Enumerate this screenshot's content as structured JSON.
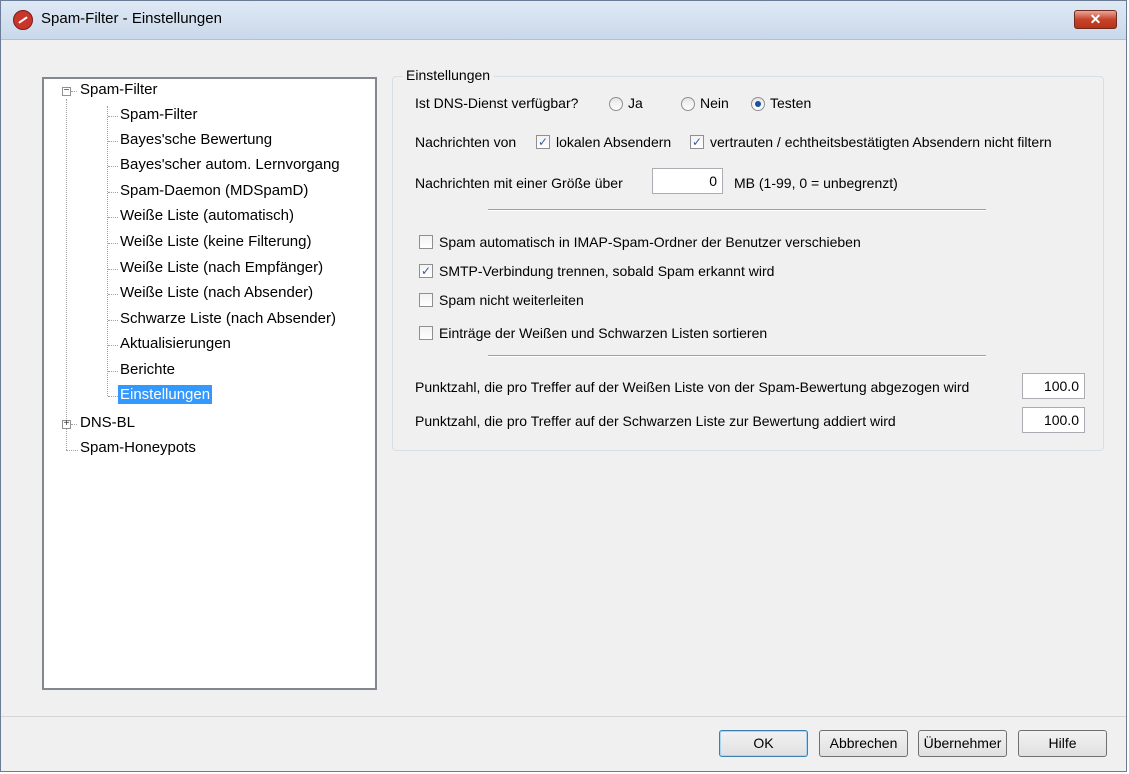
{
  "window": {
    "title": "Spam-Filter - Einstellungen",
    "close_label": "✕"
  },
  "tree": {
    "root": "Spam-Filter",
    "children": [
      "Spam-Filter",
      "Bayes'sche Bewertung",
      "Bayes'scher autom. Lernvorgang",
      "Spam-Daemon (MDSpamD)",
      "Weiße Liste (automatisch)",
      "Weiße Liste (keine Filterung)",
      "Weiße Liste (nach Empfänger)",
      "Weiße Liste (nach Absender)",
      "Schwarze Liste (nach Absender)",
      "Aktualisierungen",
      "Berichte",
      "Einstellungen"
    ],
    "other": [
      "DNS-BL",
      "Spam-Honeypots"
    ],
    "selected": "Einstellungen"
  },
  "settings": {
    "group_title": "Einstellungen",
    "dns_label": "Ist DNS-Dienst verfügbar?",
    "dns_options": [
      "Ja",
      "Nein",
      "Testen"
    ],
    "dns_selected": "Testen",
    "msg_from_label": "Nachrichten von",
    "local_senders_label": "lokalen Absendern",
    "trusted_senders_label": "vertrauten / echtheitsbestätigten Absendern nicht filtern",
    "size_label": "Nachrichten mit einer Größe über",
    "size_value": "0",
    "size_unit": "MB (1-99, 0 = unbegrenzt)",
    "checkboxes": [
      {
        "label": "Spam automatisch in IMAP-Spam-Ordner der Benutzer verschieben",
        "checked": false
      },
      {
        "label": "SMTP-Verbindung trennen, sobald Spam erkannt wird",
        "checked": true
      },
      {
        "label": "Spam nicht weiterleiten",
        "checked": false
      },
      {
        "label": "Einträge der Weißen und Schwarzen Listen sortieren",
        "checked": false
      }
    ],
    "whitelist_points_label": "Punktzahl, die pro Treffer auf der Weißen Liste von der Spam-Bewertung abgezogen wird",
    "whitelist_points_value": "100.0",
    "blacklist_points_label": "Punktzahl, die pro Treffer auf der Schwarzen Liste zur Bewertung addiert wird",
    "blacklist_points_value": "100.0"
  },
  "buttons": {
    "ok": "OK",
    "cancel": "Abbrechen",
    "apply": "Übernehmer",
    "help": "Hilfe"
  },
  "colors": {
    "selection": "#3399ff",
    "titlebar": "#dfe9f5",
    "close": "#c7432a"
  },
  "icons": {
    "app": "spam-filter-icon",
    "close": "close-icon"
  }
}
